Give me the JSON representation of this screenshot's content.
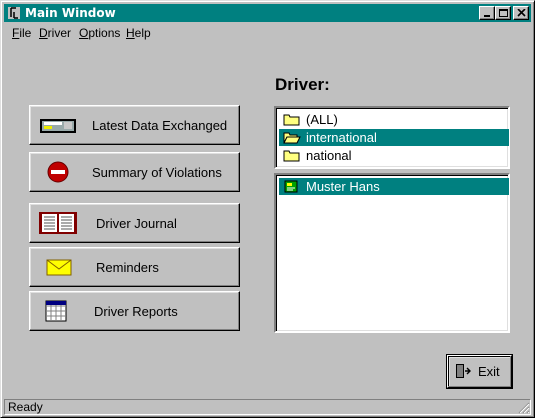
{
  "window": {
    "title": "Main Window"
  },
  "menu": {
    "items": [
      {
        "label": "File",
        "accel": "F",
        "rest": "ile"
      },
      {
        "label": "Driver",
        "accel": "D",
        "rest": "river"
      },
      {
        "label": "Options",
        "accel": "O",
        "rest": "ptions"
      },
      {
        "label": "Help",
        "accel": "H",
        "rest": "elp"
      }
    ]
  },
  "buttons": {
    "latest_data": "Latest Data Exchanged",
    "violations": "Summary of Violations",
    "journal": "Driver Journal",
    "reminders": "Reminders",
    "reports": "Driver Reports"
  },
  "driver_panel": {
    "label": "Driver:",
    "groups": [
      {
        "label": "(ALL)",
        "icon": "folder-icon",
        "selected": false
      },
      {
        "label": "international",
        "icon": "open-folder-icon",
        "selected": true
      },
      {
        "label": "national",
        "icon": "folder-icon",
        "selected": false
      }
    ],
    "drivers": [
      {
        "label": "Muster Hans",
        "icon": "driver-card-icon",
        "selected": true
      }
    ]
  },
  "exit_label": "Exit",
  "status": {
    "text": "Ready"
  },
  "colors": {
    "selection": "#008080",
    "titlebar": "#008080",
    "face": "#c0c0c0"
  }
}
